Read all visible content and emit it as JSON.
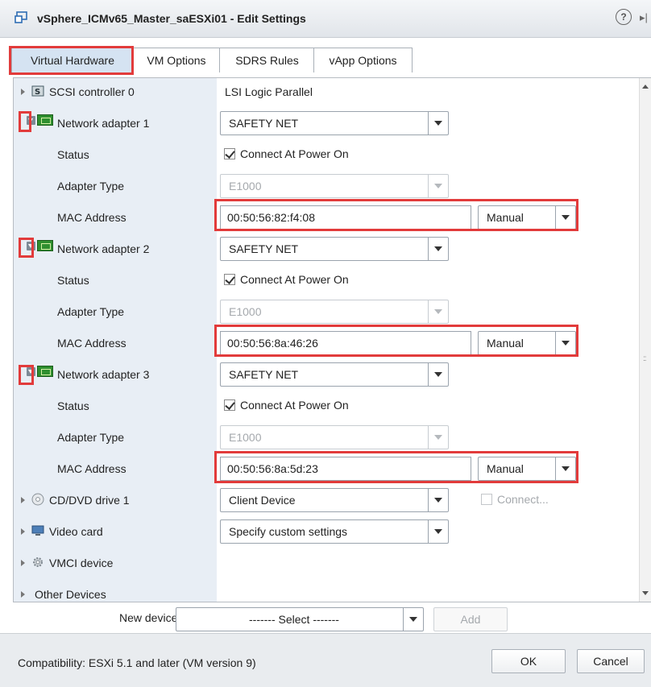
{
  "window": {
    "title": "vSphere_ICMv65_Master_saESXi01 - Edit Settings",
    "help_glyph": "?",
    "collapse_glyph": "▸|"
  },
  "tabs": [
    {
      "label": "Virtual Hardware",
      "active": true
    },
    {
      "label": "VM Options"
    },
    {
      "label": "SDRS Rules"
    },
    {
      "label": "vApp Options"
    }
  ],
  "hardware": {
    "scsi": {
      "label": "SCSI controller 0",
      "value": "LSI Logic Parallel"
    },
    "adapters": [
      {
        "label": "Network adapter 1",
        "network": "SAFETY NET",
        "status_label": "Status",
        "status_text": "Connect At Power On",
        "type_label": "Adapter Type",
        "type_value": "E1000",
        "mac_label": "MAC Address",
        "mac": "00:50:56:82:f4:08",
        "mac_mode": "Manual"
      },
      {
        "label": "Network adapter 2",
        "network": "SAFETY NET",
        "status_label": "Status",
        "status_text": "Connect At Power On",
        "type_label": "Adapter Type",
        "type_value": "E1000",
        "mac_label": "MAC Address",
        "mac": "00:50:56:8a:46:26",
        "mac_mode": "Manual"
      },
      {
        "label": "Network adapter 3",
        "network": "SAFETY NET",
        "status_label": "Status",
        "status_text": "Connect At Power On",
        "type_label": "Adapter Type",
        "type_value": "E1000",
        "mac_label": "MAC Address",
        "mac": "00:50:56:8a:5d:23",
        "mac_mode": "Manual"
      }
    ],
    "cddvd": {
      "label": "CD/DVD drive 1",
      "value": "Client Device",
      "connect_label": "Connect..."
    },
    "video": {
      "label": "Video card",
      "value": "Specify custom settings"
    },
    "vmci": {
      "label": "VMCI device"
    },
    "other": {
      "label": "Other Devices"
    }
  },
  "new_device": {
    "label": "New device:",
    "select": "------- Select -------",
    "add": "Add"
  },
  "footer": {
    "compatibility": "Compatibility: ESXi 5.1 and later (VM version 9)",
    "ok": "OK",
    "cancel": "Cancel"
  },
  "colors": {
    "highlight": "#e23b3b",
    "active_tab": "#d5e3f2",
    "label_column": "#e8eef5"
  }
}
